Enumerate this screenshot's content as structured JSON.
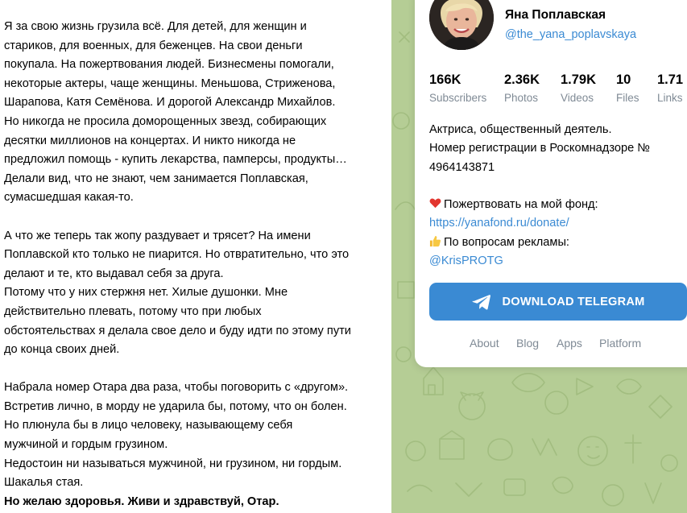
{
  "post": {
    "paragraphs": [
      {
        "text": "Я за свою жизнь грузила всё. Для детей, для женщин и\nстариков, для военных, для беженцев. На свои деньги\nпокупала. На пожертвования людей. Бизнесмены помогали,\nнекоторые актеры, чаще женщины. Меньшова, Стриженова,\nШарапова, Катя Семёнова. И дорогой Александр Михайлов.\nНо никогда не просила доморощенных звезд, собирающих\nдесятки миллионов на концертах. И никто никогда не\nпредложил помощь - купить лекарства, памперсы, продукты…\nДелали вид, что не знают, чем занимается Поплавская,\nсумасшедшая какая-то."
      },
      {
        "text": "А что же теперь так жопу раздувает и трясет? На имени\nПоплавской кто только не пиарится. Но отвратительно, что это\nделают и те, кто выдавал себя за друга.\nПотому что у них стержня нет. Хилые душонки. Мне\nдействительно плевать, потому что при любых\nобстоятельствах я делала свое дело и буду идти по этому пути\nдо конца своих дней."
      },
      {
        "text": "Набрала номер Отара два раза, чтобы поговорить с «другом».\nВстретив лично, в морду не ударила бы, потому, что он болен.\nНо плюнула бы в лицо человеку, называющему себя\nмужчиной и гордым грузином.\nНедостоин ни называться мужчиной, ни грузином, ни гордым.\nШакалья стая."
      },
      {
        "text": "Но желаю здоровья. Живи и здравствуй, Отар."
      }
    ]
  },
  "channel": {
    "name": "Яна Поплавская",
    "handle": "@the_yana_poplavskaya",
    "avatar_icon": "avatar-photo",
    "stats": [
      {
        "value": "166K",
        "label": "Subscribers"
      },
      {
        "value": "2.36K",
        "label": "Photos"
      },
      {
        "value": "1.79K",
        "label": "Videos"
      },
      {
        "value": "10",
        "label": "Files"
      },
      {
        "value": "1.71",
        "label": "Links"
      }
    ],
    "description": {
      "line1": "Актриса, общественный деятель.",
      "line2": "Номер регистрации в Роскомнадзоре №",
      "line3": "4964143871",
      "donate_emoji": "❤️",
      "donate_text": "Пожертвовать на мой фонд:",
      "donate_link": "https://yanafond.ru/donate/",
      "ads_emoji": "👍",
      "ads_text": "По вопросам рекламы:",
      "ads_link": "@KrisPROTG"
    },
    "download_button": "DOWNLOAD TELEGRAM",
    "download_icon": "telegram-plane-icon",
    "accent_color": "#3a8ad3",
    "footer_links": [
      "About",
      "Blog",
      "Apps",
      "Platform"
    ]
  }
}
